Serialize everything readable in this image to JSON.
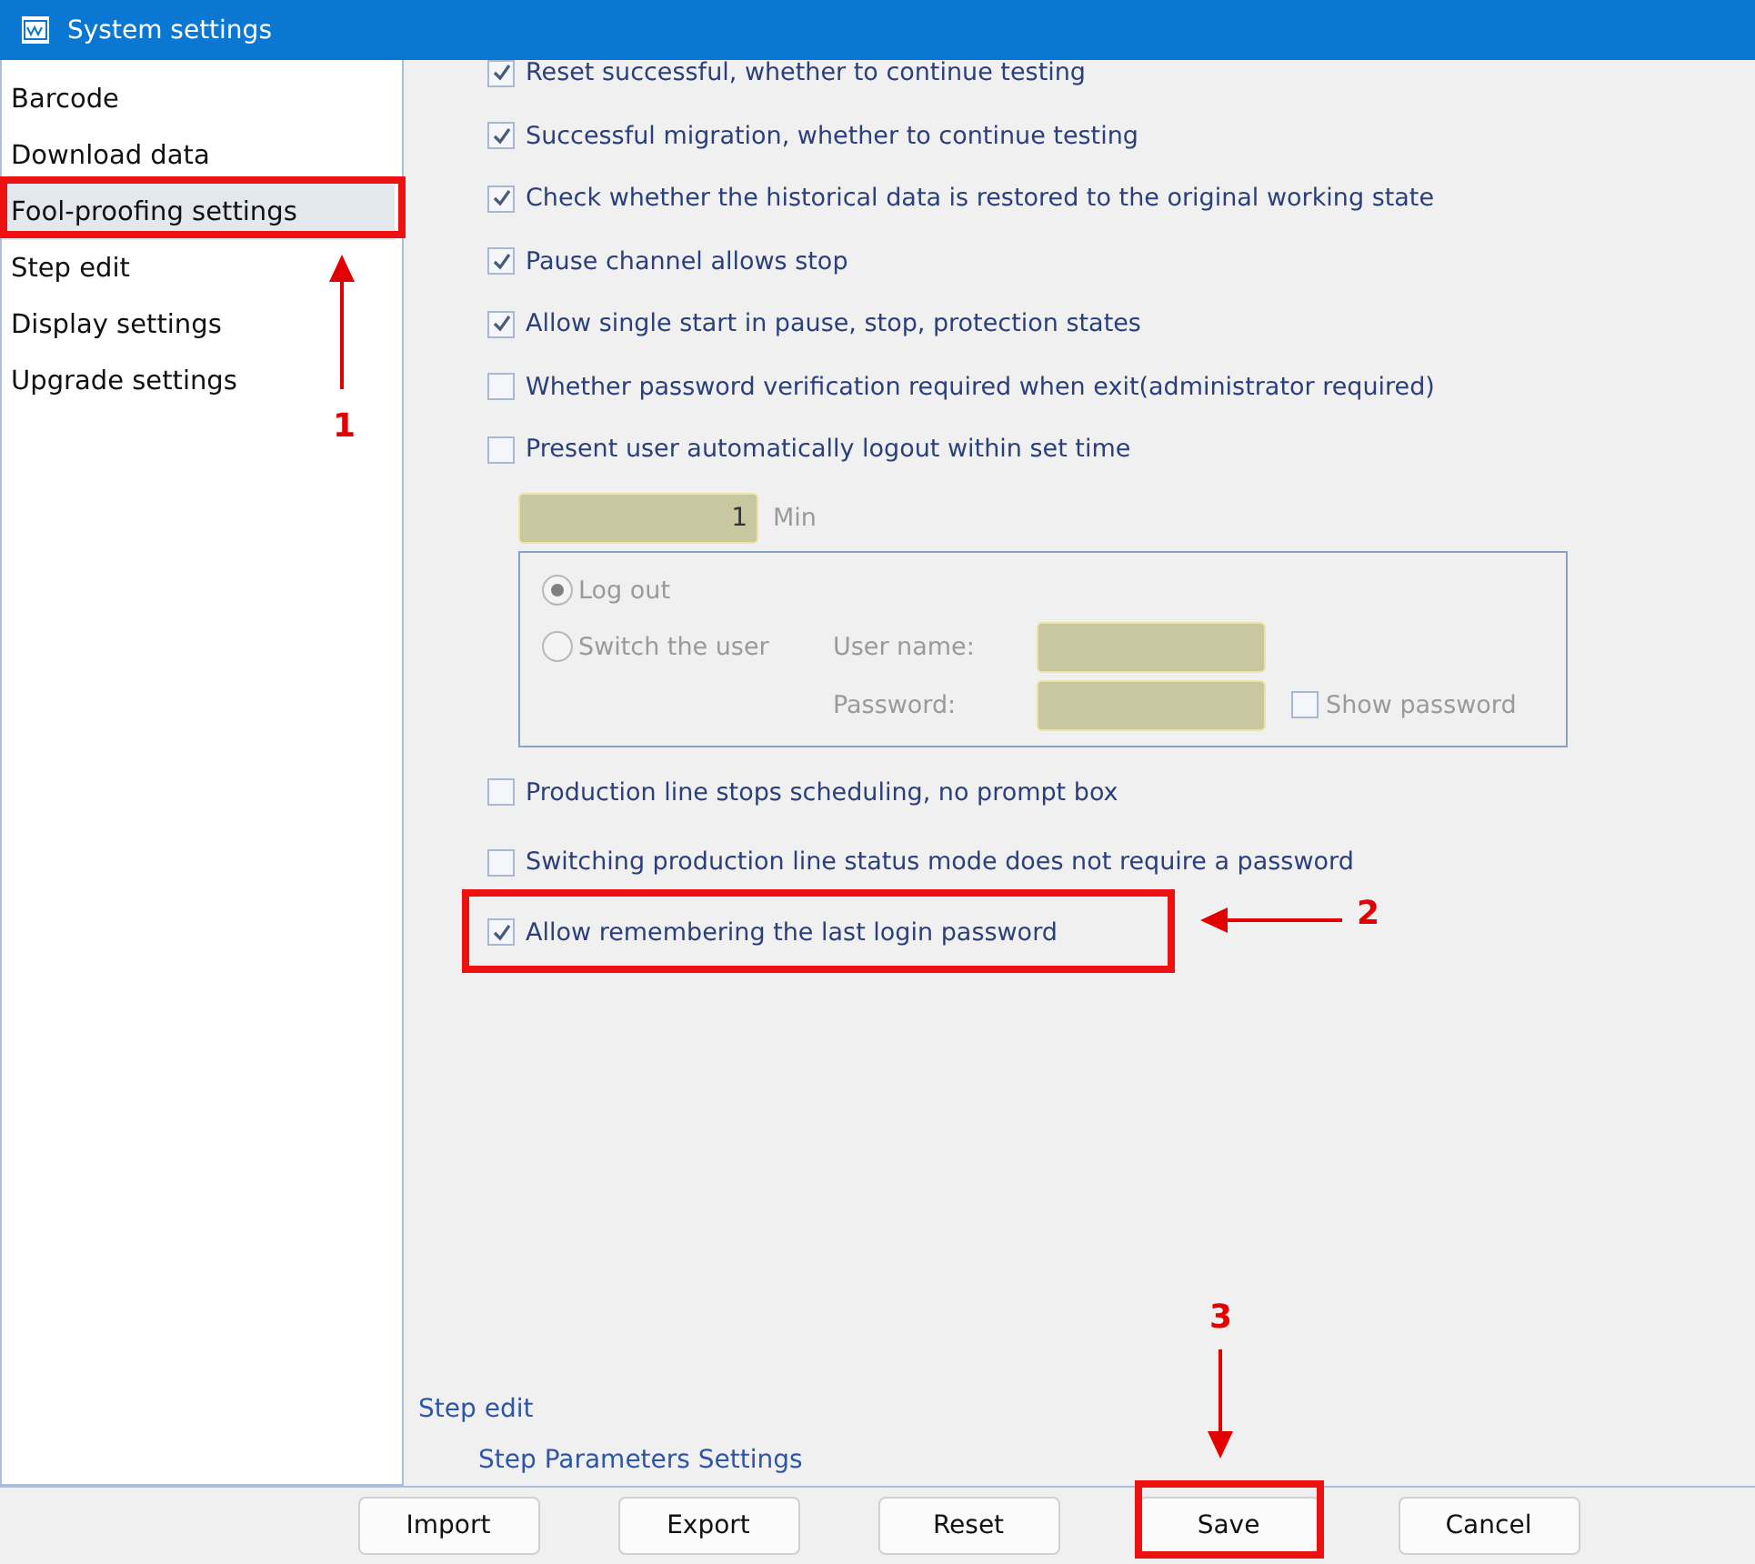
{
  "window": {
    "title": "System settings"
  },
  "sidebar": {
    "items": [
      {
        "label": "Barcode",
        "selected": false
      },
      {
        "label": "Download data",
        "selected": false
      },
      {
        "label": "Fool-proofing settings",
        "selected": true
      },
      {
        "label": "Step edit",
        "selected": false
      },
      {
        "label": "Display settings",
        "selected": false
      },
      {
        "label": "Upgrade settings",
        "selected": false
      }
    ]
  },
  "options_top": [
    {
      "label": "Reset successful, whether to continue testing",
      "checked": true
    },
    {
      "label": "Successful migration, whether to continue testing",
      "checked": true
    },
    {
      "label": "Check whether the historical data is restored to the original working state",
      "checked": true
    },
    {
      "label": "Pause channel allows stop",
      "checked": true
    },
    {
      "label": "Allow single start in pause, stop, protection states",
      "checked": true
    },
    {
      "label": "Whether password verification required when exit(administrator required)",
      "checked": false
    },
    {
      "label": "Present user automatically logout within set time",
      "checked": false
    }
  ],
  "logout_settings": {
    "disabled": true,
    "minutes": "1",
    "unit": "Min",
    "radios": [
      {
        "label": "Log out",
        "selected": true
      },
      {
        "label": "Switch the user",
        "selected": false
      }
    ],
    "user_name_label": "User name:",
    "password_label": "Password:",
    "show_password": {
      "label": "Show password",
      "checked": false
    }
  },
  "options_bottom": [
    {
      "label": "Production line stops scheduling, no prompt box",
      "checked": false
    },
    {
      "label": "Switching production line status mode does not require a password",
      "checked": false
    },
    {
      "label": "Allow remembering the last login password",
      "checked": true
    }
  ],
  "breadcrumb": [
    {
      "label": "Step edit"
    },
    {
      "label": "Step Parameters Settings"
    }
  ],
  "buttons": [
    {
      "label": "Import"
    },
    {
      "label": "Export"
    },
    {
      "label": "Reset"
    },
    {
      "label": "Save"
    },
    {
      "label": "Cancel"
    }
  ],
  "annotations": [
    {
      "number": "1"
    },
    {
      "number": "2"
    },
    {
      "number": "3"
    }
  ]
}
